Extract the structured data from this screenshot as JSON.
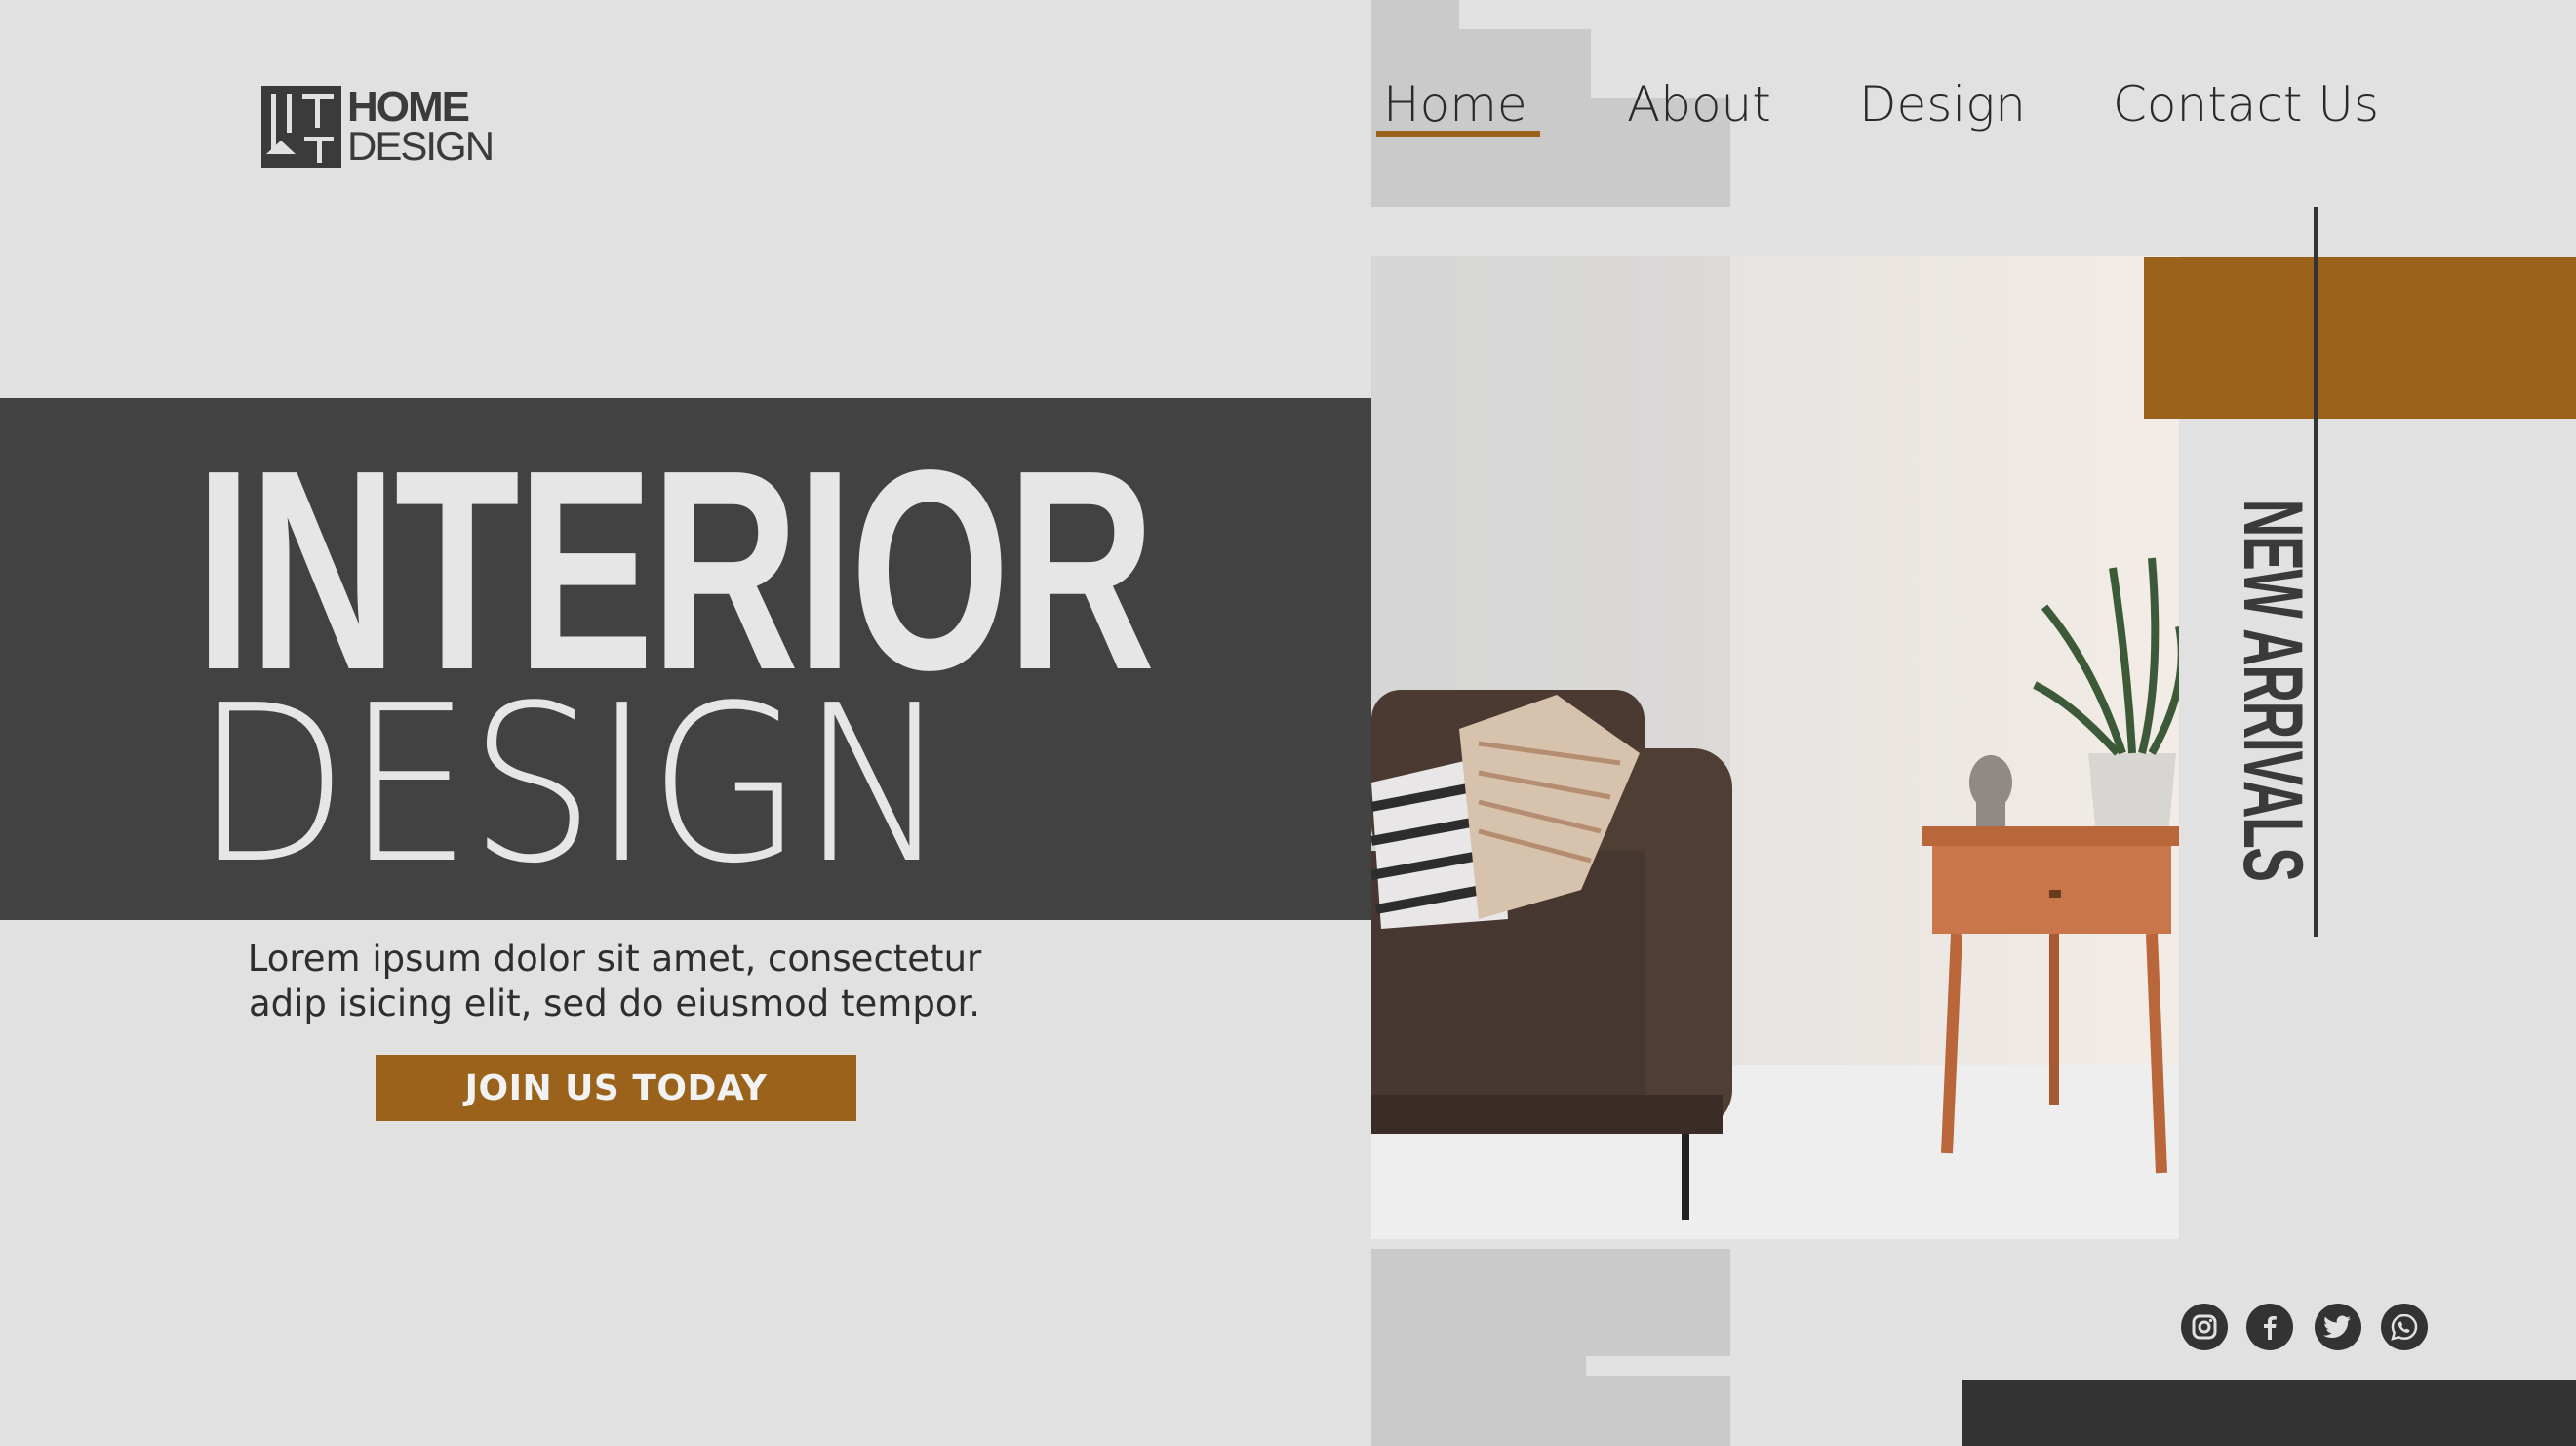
{
  "logo": {
    "line1": "HOME",
    "line2": "DESIGN"
  },
  "nav": {
    "items": [
      {
        "label": "Home",
        "active": true
      },
      {
        "label": "About"
      },
      {
        "label": "Design"
      },
      {
        "label": "Contact Us"
      }
    ]
  },
  "hero": {
    "title_line1": "INTERIOR",
    "title_line2": "DESIGN",
    "description_line1": "Lorem ipsum dolor sit amet, consectetur",
    "description_line2": "adip isicing elit, sed do eiusmod tempor.",
    "cta_label": "JOIN US TODAY"
  },
  "side_label": "NEW ARRIVALS",
  "social": [
    "instagram-icon",
    "facebook-icon",
    "twitter-icon",
    "whatsapp-icon"
  ],
  "colors": {
    "background": "#e1e1e1",
    "dark": "#424242",
    "accent": "#9a621a",
    "text": "#2a2a2a"
  }
}
